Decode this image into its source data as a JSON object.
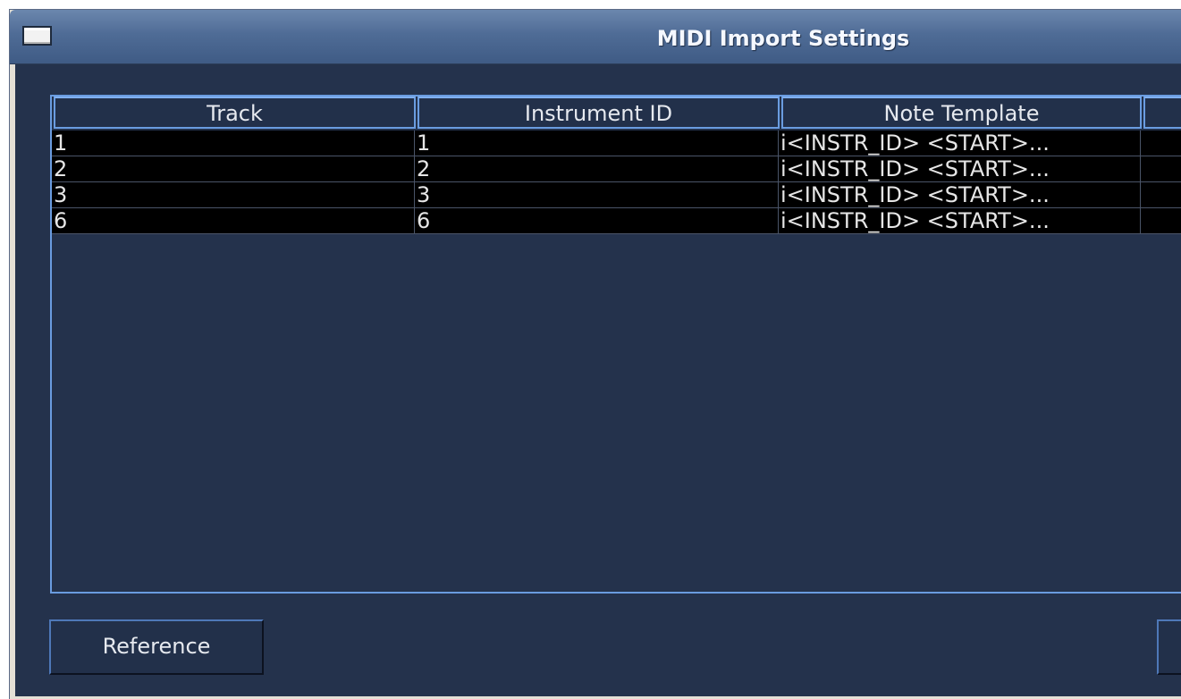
{
  "window": {
    "title": "MIDI Import Settings"
  },
  "table": {
    "columns": [
      "Track",
      "Instrument ID",
      "Note Template",
      ""
    ],
    "rows": [
      [
        "1",
        "1",
        "i<INSTR_ID> <START>...",
        ""
      ],
      [
        "2",
        "2",
        "i<INSTR_ID> <START>...",
        ""
      ],
      [
        "3",
        "3",
        "i<INSTR_ID> <START>...",
        ""
      ],
      [
        "6",
        "6",
        "i<INSTR_ID> <START>...",
        ""
      ]
    ]
  },
  "buttons": {
    "reference": "Reference",
    "right_partial": ""
  },
  "colors": {
    "background": "#24324c",
    "accent_border": "#6a9ce0",
    "row_background": "#000000",
    "text": "#e6e9ef"
  }
}
